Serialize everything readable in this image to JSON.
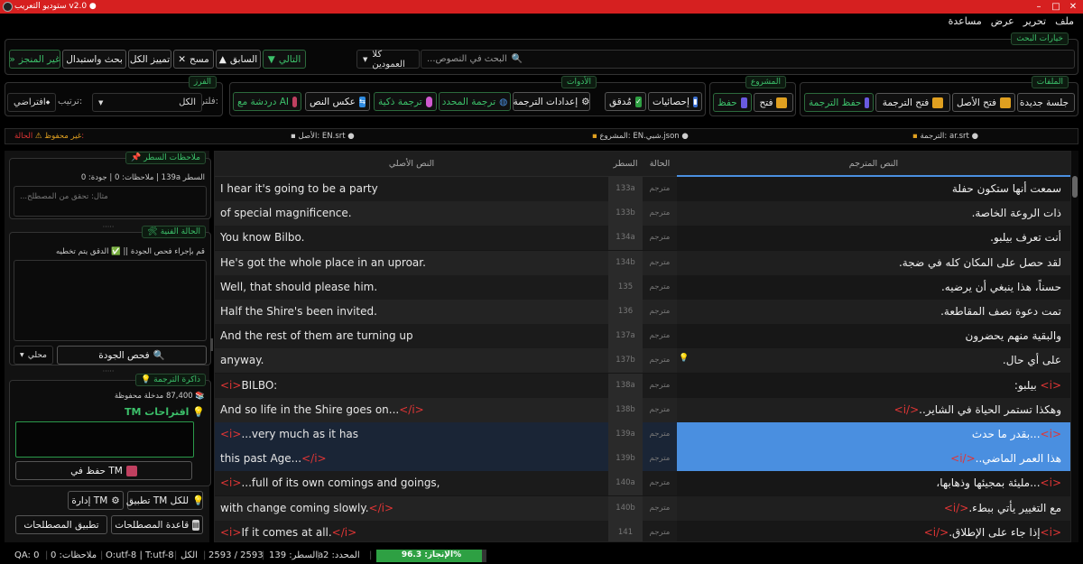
{
  "window": {
    "title": "ستوديو التعريب v2.0 ●"
  },
  "menu": [
    "ملف",
    "تحرير",
    "عرض",
    "مساعدة"
  ],
  "search": {
    "group": "خيارات البحث",
    "placeholder": "البحث في النصوص...",
    "search_icon": "magnifier",
    "scope": "كلا العمودين",
    "next": "التالي",
    "prev": "السابق",
    "clear": "مسح",
    "select_all": "تمييز الكل",
    "replace": "بحث واستبدال",
    "untranslated": "غير المنجز"
  },
  "files": {
    "group": "الملفات",
    "new_session": "جلسة جديدة",
    "open_source": "فتح الأصل",
    "open_translation": "فتح الترجمة",
    "save_translation": "حفظ الترجمة"
  },
  "project": {
    "group": "المشروع",
    "open": "فتح",
    "save": "حفظ"
  },
  "tools": {
    "group": "الأدوات",
    "stats": "إحصائيات",
    "checked": "مُدقق",
    "translation_settings": "إعدادات الترجمة",
    "translate_selected": "ترجمة المحدد",
    "smart_translate": "ترجمة ذكية",
    "reverse_text": "عكس النص",
    "ai_chat": "دردشة مع AI"
  },
  "sort": {
    "group": "الفرز",
    "filter_label": "فلتر:",
    "filter_value": "الكل",
    "order_label": "ترتيب:",
    "order_value": "افتراضي"
  },
  "infobar": {
    "translation": "الترجمة: ar.srt ●",
    "project": "المشروع: EN.شبي.json ●",
    "source": "الأصل: EN.srt ●",
    "state_label": "الحالة:",
    "state_value": "غير محفوظ"
  },
  "table": {
    "headers": {
      "original": "النص الأصلي",
      "line": "السطر",
      "status": "الحالة",
      "translation": "النص المترجم"
    },
    "rows": [
      {
        "orig": "I hear it's going to be a party",
        "line": "133a",
        "status": "مترجم",
        "trans": "سمعت أنها ستكون حفلة"
      },
      {
        "orig": "of special magnificence.",
        "line": "133b",
        "status": "مترجم",
        "trans": "ذات الروعة الخاصة."
      },
      {
        "orig": "You know Bilbo.",
        "line": "134a",
        "status": "مترجم",
        "trans": "أنت تعرف بيلبو."
      },
      {
        "orig": "He's got the whole place in an uproar.",
        "line": "134b",
        "status": "مترجم",
        "trans": "لقد حصل على المكان كله في ضجة."
      },
      {
        "orig": "Well, that should please him.",
        "line": "135",
        "status": "مترجم",
        "trans": "حسناً، هذا ينبغي أن يرضيه."
      },
      {
        "orig": "Half the Shire's been invited.",
        "line": "136",
        "status": "مترجم",
        "trans": "تمت دعوة نصف المقاطعة."
      },
      {
        "orig": "And the rest of them are turning up",
        "line": "137a",
        "status": "مترجم",
        "trans": "والبقية منهم يحضرون"
      },
      {
        "orig": "anyway.",
        "line": "137b",
        "status": "مترجم",
        "trans": "على أي حال.",
        "bulb": true
      },
      {
        "orig_pre": "<i>",
        "orig": "BILBO:",
        "line": "138a",
        "status": "مترجم",
        "trans_pre": "<i>",
        "trans": " بيلبو:"
      },
      {
        "orig": "And so life in the Shire goes on...",
        "orig_post": "</i>",
        "line": "138b",
        "status": "مترجم",
        "trans": "وهكذا تستمر الحياة في الشاير..",
        "trans_post": "</i>"
      },
      {
        "orig_pre": "<i>",
        "orig": "...very much as it has",
        "line": "139a",
        "status": "مترجم",
        "trans_pre": "<i>",
        "trans": "...بقدر ما حدث",
        "sel": true
      },
      {
        "orig": "this past Age...",
        "orig_post": "</i>",
        "line": "139b",
        "status": "مترجم",
        "trans": "هذا العمر الماضي..",
        "trans_post": "</i>",
        "sel": true
      },
      {
        "orig_pre": "<i>",
        "orig": "...full of its own comings and goings,",
        "line": "140a",
        "status": "مترجم",
        "trans_pre": "<i>",
        "trans": "...مليئة بمجيئها وذهابها،"
      },
      {
        "orig": "with change coming slowly.",
        "orig_post": "</i>",
        "line": "140b",
        "status": "مترجم",
        "trans": "مع التغيير يأتي ببطء.",
        "trans_post": "</i>"
      },
      {
        "orig_pre": "<i>",
        "orig": "If it comes at all.",
        "orig_post": "</i>",
        "line": "141",
        "status": "مترجم",
        "trans_pre": "<i>",
        "trans": "إذا جاء على الإطلاق.",
        "trans_post": "</i>"
      }
    ]
  },
  "notes": {
    "group": "ملاحظات السطر",
    "info": "السطر 139a | ملاحظات: 0 | جودة: 0",
    "placeholder": "مثال: تحقق من المصطلح..."
  },
  "tech": {
    "group": "الحالة الفنية",
    "info": "قم بإجراء فحص الجودة || ✅ الدقق يتم تخطيه",
    "quality_check": "فحص الجودة",
    "local": "محلي"
  },
  "tm": {
    "group": "ذاكرة الترجمة",
    "count": "87,400 مدخلة محفوظة",
    "suggestions": "اقتراحات TM",
    "save": "حفظ في TM",
    "apply_all": "تطبيق TM للكل",
    "manage": "إدارة TM",
    "glossary": "قاعدة المصطلحات",
    "apply_terms": "تطبيق المصطلحات"
  },
  "status": {
    "progress_label": "الإنجاز: 96.3%",
    "progress": 0.963,
    "selected": "المحدد: 2",
    "line": "السطر: 139a",
    "count": "2593 / 2593",
    "all": "الكل",
    "enc": "O:utf-8 | T:utf-8",
    "notes": "ملاحظات: 0",
    "qa": "QA: 0"
  },
  "colors": {
    "accent": "#3cc06a",
    "selection": "#4a8fe0",
    "tag": "#e03535",
    "titlebar": "#d62020"
  }
}
